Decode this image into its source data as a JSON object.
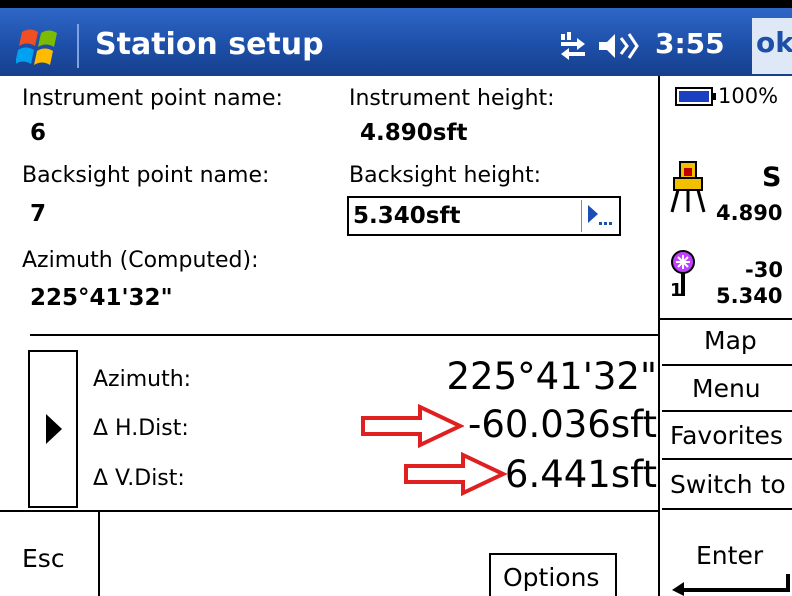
{
  "titlebar": {
    "title": "Station setup",
    "time": "3:55",
    "ok": "ok",
    "icons": [
      "windows-start-icon",
      "connectivity-icon",
      "volume-icon"
    ],
    "bg_color": "#1d4fa8"
  },
  "form": {
    "instrument_point_label": "Instrument point name:",
    "instrument_point_value": "6",
    "instrument_height_label": "Instrument height:",
    "instrument_height_value": "4.890sft",
    "backsight_point_label": "Backsight point name:",
    "backsight_point_value": "7",
    "backsight_height_label": "Backsight height:",
    "backsight_height_value": "5.340sft",
    "azimuth_computed_label": "Azimuth (Computed):",
    "azimuth_computed_value": "225°41'32\""
  },
  "results": {
    "azimuth_label": "Azimuth:",
    "azimuth_value": "225°41'32\"",
    "hdist_label": "Δ H.Dist:",
    "hdist_value": "-60.036sft",
    "vdist_label": "Δ V.Dist:",
    "vdist_value": "6.441sft",
    "arrow_color": "#e02020"
  },
  "sidepanel": {
    "battery": "100%",
    "instrument_letter": "S",
    "instrument_height": "4.890",
    "target_offset": "-30",
    "target_height": "5.340",
    "target_number": "1",
    "buttons": [
      "Map",
      "Menu",
      "Favorites",
      "Switch to"
    ]
  },
  "bottom": {
    "esc": "Esc",
    "options": "Options",
    "enter": "Enter"
  }
}
